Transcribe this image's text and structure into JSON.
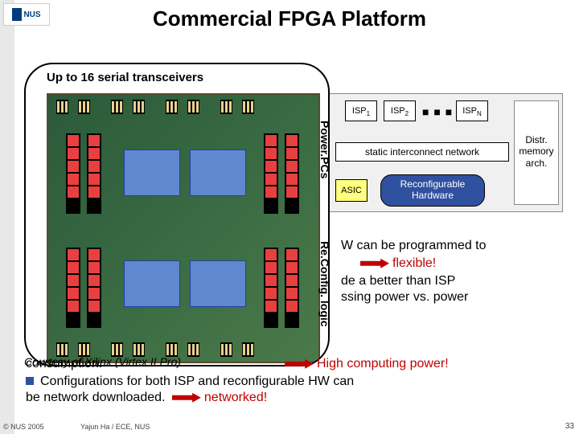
{
  "slide": {
    "title": "Commercial FPGA Platform",
    "callout_title": "Up to 16 serial transceivers",
    "credit": "Courtesy of Xilinx (Virtex II Pro)",
    "label_powerpcs": "Power.PCs",
    "label_reconfig": "Re.Config. logic",
    "page_number": "33"
  },
  "arch": {
    "isp1": "ISP",
    "isp1_sub": "1",
    "isp2": "ISP",
    "isp2_sub": "2",
    "ispn": "ISP",
    "ispn_sub": "N",
    "dots": "■ ■ ■",
    "interconnect": "static interconnect network",
    "asic": "ASIC",
    "reconf": "Reconfigurable Hardware",
    "distr": "Distr. memory arch."
  },
  "body": {
    "line1a": "W can be programmed to",
    "line2": "flexible!",
    "line3": "de a better than ISP",
    "line4": "ssing power vs. power",
    "line5a": "consumption.",
    "line5b": "High computing power!",
    "line6": "Configurations for both ISP and reconfigurable HW can",
    "line7a": "be network downloaded.",
    "line7b": "networked!"
  },
  "footer": {
    "copyright": "© NUS 2005",
    "author": "Yajun Ha / ECE, NUS"
  },
  "logo": {
    "text": "NUS"
  }
}
